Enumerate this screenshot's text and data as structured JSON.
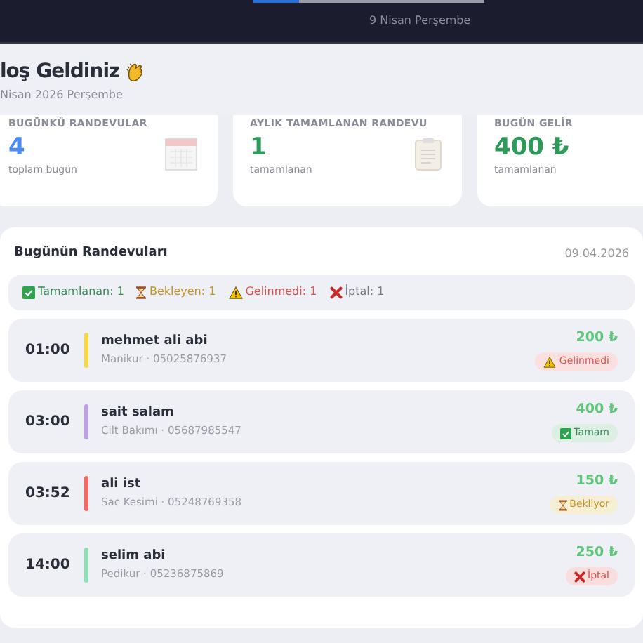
{
  "top_bar": {
    "date": "9 Nisan Perşembe",
    "loading_bar": {
      "level": 0.2
    }
  },
  "header": {
    "title": "loş Geldiniz",
    "subtitle": "Nisan 2026 Perşembe"
  },
  "stats": [
    {
      "label": "BUGÜNKÜ RANDEVULAR",
      "value": "4",
      "caption": "toplam bugün",
      "color": "#4a8af4",
      "kind": "calendar"
    },
    {
      "label": "AYLIK TAMAMLANAN RANDEVU",
      "value": "1",
      "caption": "tamamlanan",
      "color": "#2e9a5a",
      "kind": "clipboard"
    },
    {
      "label": "BUGÜN GELİR",
      "value": "400 ₺",
      "caption": "tamamlanan",
      "color": "#2e9a5a",
      "kind": "plain"
    }
  ],
  "appointments": {
    "title": "Bugünün Randevuları",
    "date": "09.04.2026",
    "summary": [
      {
        "kind": "done",
        "text": "Tamamlanan: 1"
      },
      {
        "kind": "waiting",
        "text": "Bekleyen: 1"
      },
      {
        "kind": "noshow",
        "text": "Gelinmedi: 1"
      },
      {
        "kind": "cancelled",
        "text": "İptal: 1"
      }
    ],
    "rows": [
      {
        "time": "01:00",
        "color": "#f5d84a",
        "name": "mehmet ali abi",
        "details": "Manikur · 05025876937",
        "amount": "200 ₺",
        "status": {
          "kind": "noshow",
          "text": "Gelinmedi"
        }
      },
      {
        "time": "03:00",
        "color": "#b9a3e0",
        "name": "sait salam",
        "details": "Cilt Bakımı · 05687985547",
        "amount": "400 ₺",
        "status": {
          "kind": "done",
          "text": "Tamam"
        }
      },
      {
        "time": "03:52",
        "color": "#f26b6b",
        "name": "ali ist",
        "details": "Sac Kesimi · 05248769358",
        "amount": "150 ₺",
        "status": {
          "kind": "waiting",
          "text": "Bekliyor"
        }
      },
      {
        "time": "14:00",
        "color": "#8fdcb5",
        "name": "selim abi",
        "details": "Pedikur · 05236875869",
        "amount": "250 ₺",
        "status": {
          "kind": "cancelled",
          "text": "İptal"
        }
      }
    ]
  }
}
